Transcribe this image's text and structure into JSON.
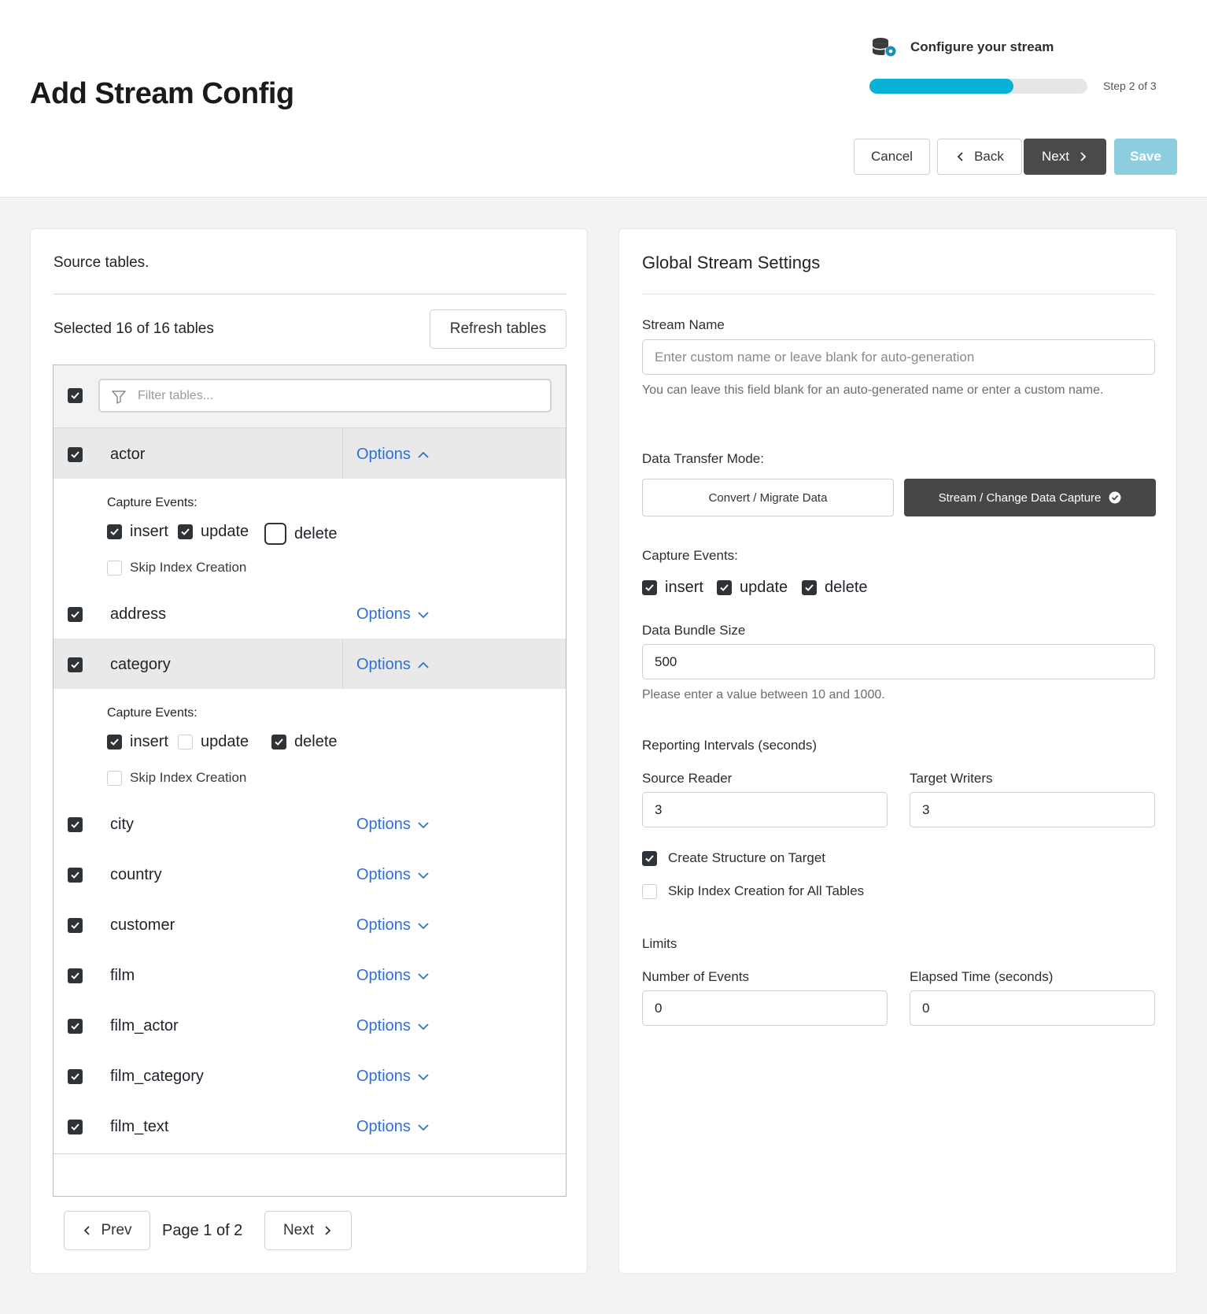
{
  "header": {
    "title": "Add Stream Config",
    "step_title": "Configure your stream",
    "step_count": "Step 2 of 3",
    "progress_fraction": 0.66,
    "buttons": {
      "cancel": "Cancel",
      "back": "Back",
      "next": "Next",
      "save": "Save"
    }
  },
  "source": {
    "title": "Source tables.",
    "selected": "Selected 16 of 16 tables",
    "refresh": "Refresh tables",
    "filter_placeholder": "Filter tables...",
    "options_label": "Options",
    "capture_label": "Capture Events:",
    "skip_label": "Skip Index Creation",
    "tables": [
      {
        "name": "actor",
        "checked": true,
        "expanded": true,
        "events": {
          "insert": true,
          "update": true,
          "delete": false
        },
        "skip_index": false
      },
      {
        "name": "address",
        "checked": true,
        "expanded": false
      },
      {
        "name": "category",
        "checked": true,
        "expanded": true,
        "events": {
          "insert": true,
          "update": false,
          "delete": true
        },
        "skip_index": false
      },
      {
        "name": "city",
        "checked": true,
        "expanded": false
      },
      {
        "name": "country",
        "checked": true,
        "expanded": false
      },
      {
        "name": "customer",
        "checked": true,
        "expanded": false
      },
      {
        "name": "film",
        "checked": true,
        "expanded": false
      },
      {
        "name": "film_actor",
        "checked": true,
        "expanded": false
      },
      {
        "name": "film_category",
        "checked": true,
        "expanded": false
      },
      {
        "name": "film_text",
        "checked": true,
        "expanded": false
      }
    ],
    "event_labels": {
      "insert": "insert",
      "update": "update",
      "delete": "delete"
    },
    "pager": {
      "prev": "Prev",
      "label": "Page 1 of 2",
      "next": "Next"
    }
  },
  "global": {
    "title": "Global Stream Settings",
    "stream_name_label": "Stream Name",
    "stream_name_placeholder": "Enter custom name or leave blank for auto-generation",
    "stream_name_hint": "You can leave this field blank for an auto-generated name or enter a custom name.",
    "mode_label": "Data Transfer Mode:",
    "mode_convert": "Convert / Migrate Data",
    "mode_stream": "Stream / Change Data Capture",
    "capture_label": "Capture Events:",
    "events": {
      "insert": "insert",
      "update": "update",
      "delete": "delete"
    },
    "bundle_label": "Data Bundle Size",
    "bundle_value": "500",
    "bundle_hint": "Please enter a value between 10 and 1000.",
    "reporting_label": "Reporting Intervals (seconds)",
    "source_reader_label": "Source Reader",
    "source_reader_value": "3",
    "target_writers_label": "Target Writers",
    "target_writers_value": "3",
    "create_structure": "Create Structure on Target",
    "skip_index_all": "Skip Index Creation for All Tables",
    "limits_label": "Limits",
    "events_label": "Number of Events",
    "events_value": "0",
    "elapsed_label": "Elapsed Time (seconds)",
    "elapsed_value": "0"
  },
  "colors": {
    "accent": "#08b1d5",
    "link": "#2f6fd6",
    "dark": "#474747",
    "save": "#8dcde0"
  }
}
